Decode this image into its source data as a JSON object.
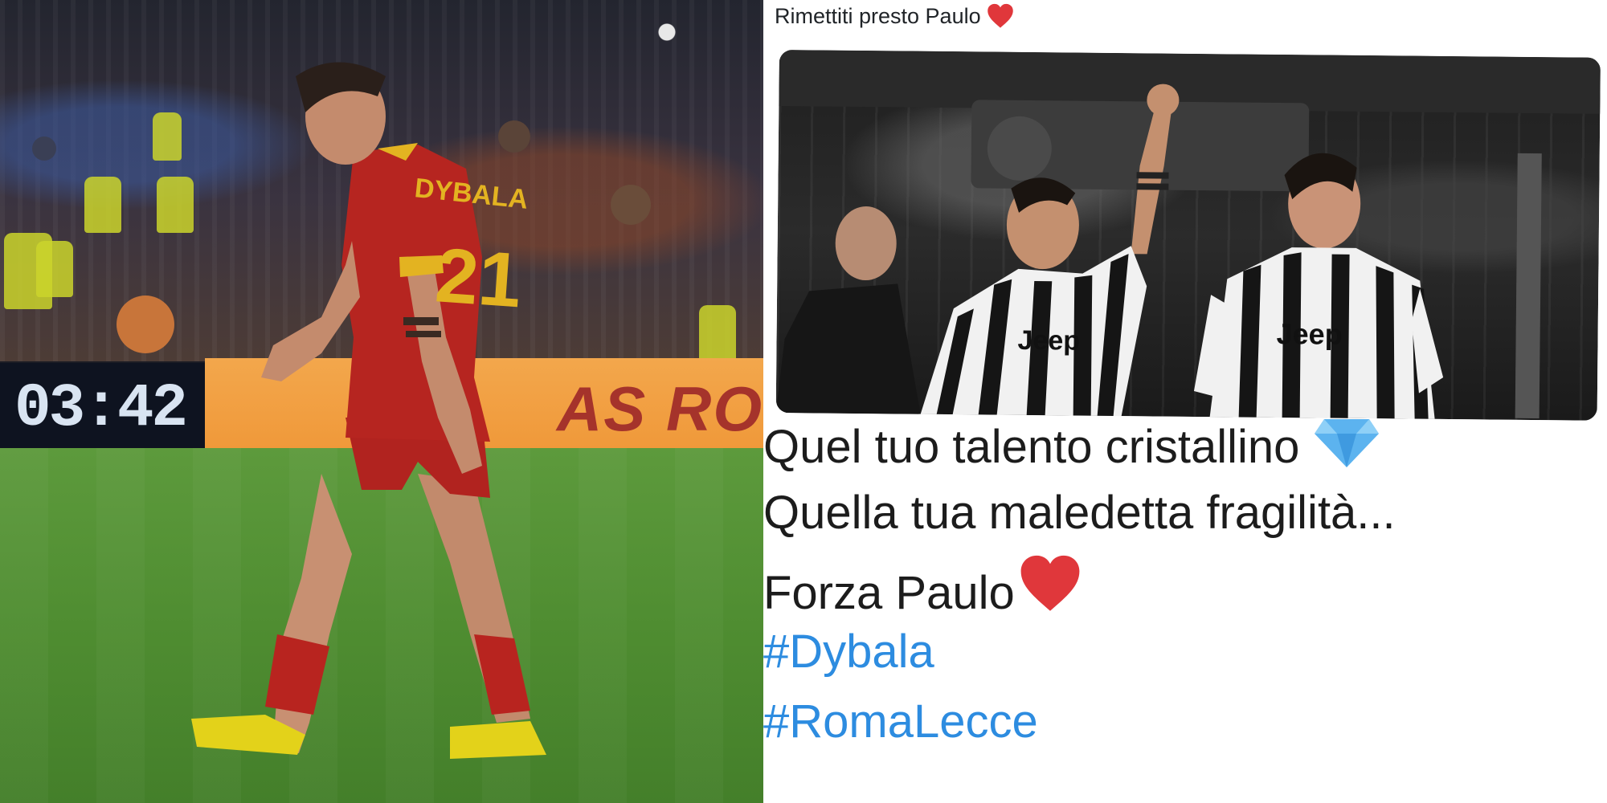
{
  "left_photo": {
    "scoreboard_time": "03:42",
    "ad_board_text": "AS RO",
    "jersey_name": "DYBALA",
    "jersey_number": "21"
  },
  "tweet": {
    "header_text": "Rimettiti presto Paulo",
    "image_jersey_text_1": "Jeep",
    "image_jersey_text_2": "Jeep",
    "lines": [
      "Quel tuo talento cristallino",
      "Quella tua maledetta fragilità...",
      "Forza Paulo"
    ],
    "hashtags": [
      "#Dybala",
      "#RomaLecce"
    ],
    "icons": [
      "heart-emoji",
      "gem-emoji",
      "heart-emoji"
    ],
    "colors": {
      "hashtag": "#2d8ce0",
      "heart": "#e0373b",
      "gem": "#5cb3ef"
    }
  }
}
